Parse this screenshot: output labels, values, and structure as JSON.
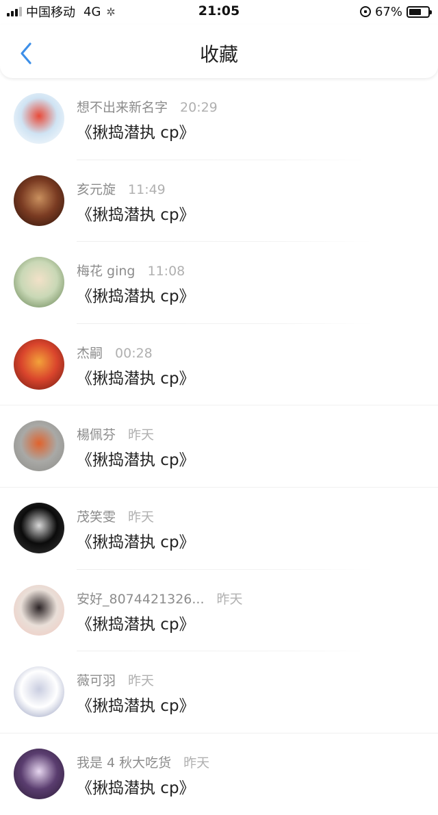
{
  "status_bar": {
    "carrier": "中国移动",
    "network": "4G",
    "time": "21:05",
    "battery": "67%",
    "battery_level": 0.67
  },
  "nav": {
    "title": "收藏",
    "back_icon": "chevron-left-icon",
    "accent": "#3d8fe8"
  },
  "items": [
    {
      "user": "想不出来新名字",
      "time": "20:29",
      "title": "《揪捣潜执 cp》",
      "avatar_colors": [
        "#cfe3f3",
        "#e84b3a",
        "#ffffff"
      ]
    },
    {
      "user": "亥元旋",
      "time": "11:49",
      "title": "《揪捣潜执 cp》",
      "avatar_colors": [
        "#7a3b22",
        "#c9905e",
        "#2a120a"
      ]
    },
    {
      "user": "梅花 ging",
      "time": "11:08",
      "title": "《揪捣潜执 cp》",
      "avatar_colors": [
        "#c9d8b6",
        "#f2e1c8",
        "#5e7d4c"
      ]
    },
    {
      "user": "杰嗣",
      "time": "00:28",
      "title": "《揪捣潜执 cp》",
      "avatar_colors": [
        "#d9442c",
        "#f3a23a",
        "#6b1b12"
      ]
    },
    {
      "user": "楊佩芬",
      "time": "昨天",
      "title": "《揪捣潜执 cp》",
      "avatar_colors": [
        "#a9a9a6",
        "#e0632d",
        "#8a8a86"
      ]
    },
    {
      "user": "茂笑雯",
      "time": "昨天",
      "title": "《揪捣潜执 cp》",
      "avatar_colors": [
        "#0b0b0b",
        "#d8d8d8",
        "#3a3a3a"
      ]
    },
    {
      "user": "安好_8074421326...",
      "time": "昨天",
      "title": "《揪捣潜执 cp》",
      "avatar_colors": [
        "#e9dfd8",
        "#2b2325",
        "#f2c9c0"
      ]
    },
    {
      "user": "薇可羽",
      "time": "昨天",
      "title": "《揪捣潜执 cp》",
      "avatar_colors": [
        "#ffffff",
        "#c9cde0",
        "#8a93b8"
      ]
    },
    {
      "user": "我是 4 秋大吃货",
      "time": "昨天",
      "title": "《揪捣潜执 cp》",
      "avatar_colors": [
        "#5a3d6f",
        "#e6d6ef",
        "#2a1b35"
      ]
    }
  ]
}
